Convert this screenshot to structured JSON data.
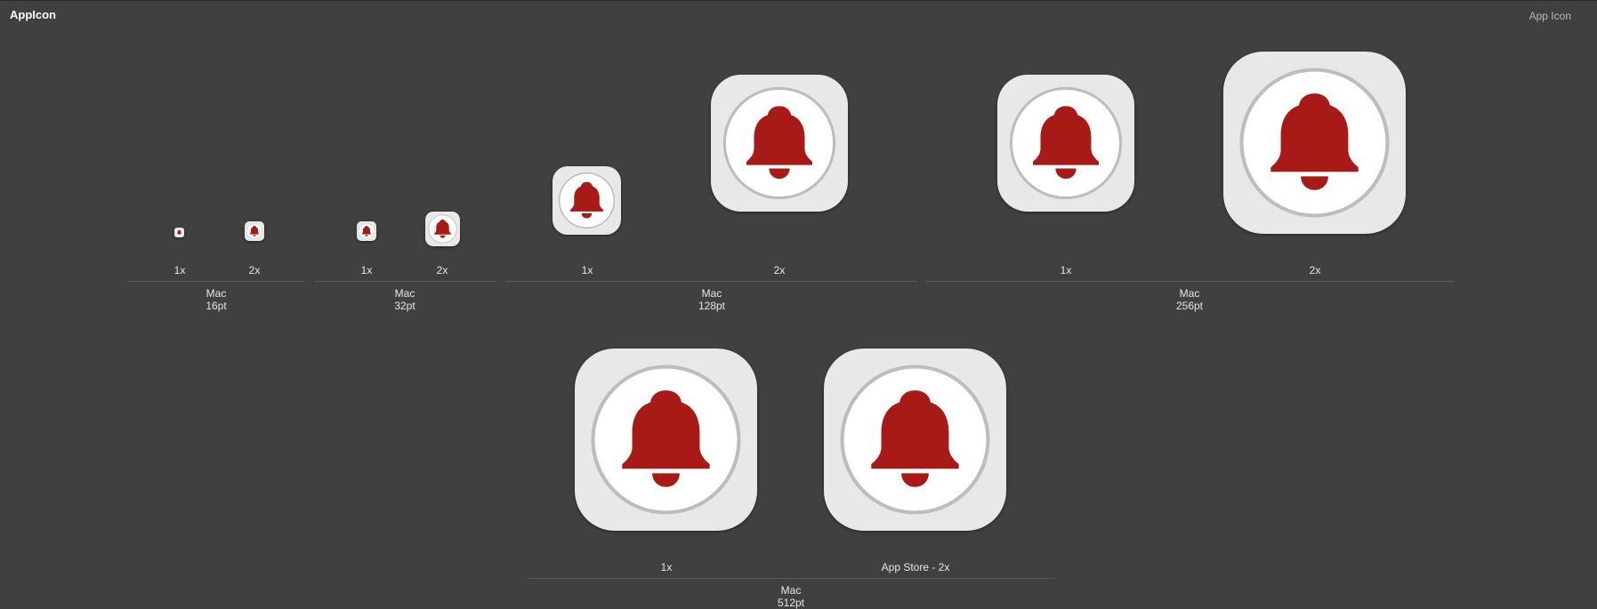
{
  "header": {
    "title": "AppIcon",
    "subtitle": "App Icon"
  },
  "colors": {
    "background": "#404040",
    "icon_plate": "#e8e8e8",
    "bell": "#a71a16",
    "ring": "#bdbdbd"
  },
  "icon": {
    "name": "bell-icon"
  },
  "groups": [
    {
      "platform": "Mac",
      "size": "16pt",
      "scales": [
        "1x",
        "2x"
      ]
    },
    {
      "platform": "Mac",
      "size": "32pt",
      "scales": [
        "1x",
        "2x"
      ]
    },
    {
      "platform": "Mac",
      "size": "128pt",
      "scales": [
        "1x",
        "2x"
      ]
    },
    {
      "platform": "Mac",
      "size": "256pt",
      "scales": [
        "1x",
        "2x"
      ]
    },
    {
      "platform": "Mac",
      "size": "512pt",
      "scales": [
        "1x",
        "App Store - 2x"
      ]
    }
  ]
}
